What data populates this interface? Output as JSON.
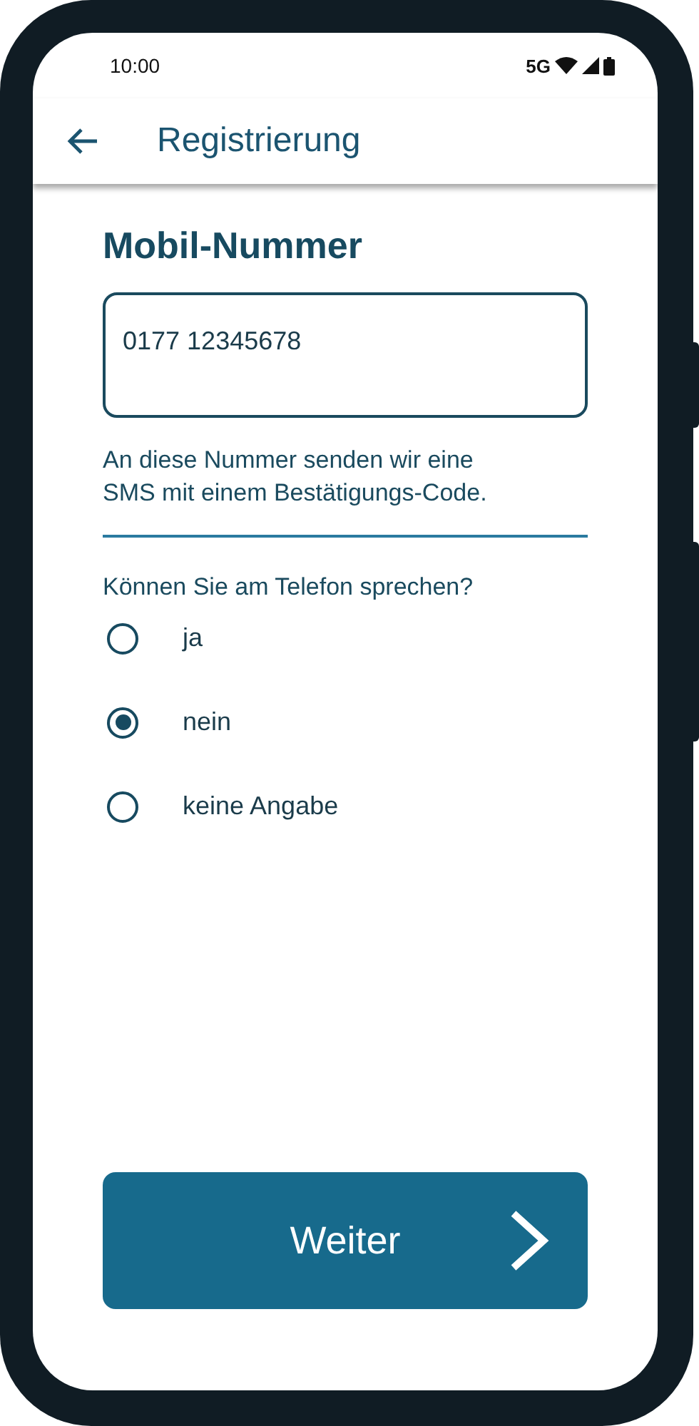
{
  "status_bar": {
    "time": "10:00",
    "network": "5G"
  },
  "app_bar": {
    "title": "Registrierung"
  },
  "heading": "Mobil-Nummer",
  "phone_field": {
    "value": "0177 12345678"
  },
  "hint": "An diese Nummer senden wir eine SMS mit einem Bestätigungs-Code.",
  "question": "Können Sie am Telefon sprechen?",
  "options": [
    {
      "label": "ja",
      "selected": false
    },
    {
      "label": "nein",
      "selected": true
    },
    {
      "label": "keine Angabe",
      "selected": false
    }
  ],
  "next_button": {
    "label": "Weiter"
  }
}
